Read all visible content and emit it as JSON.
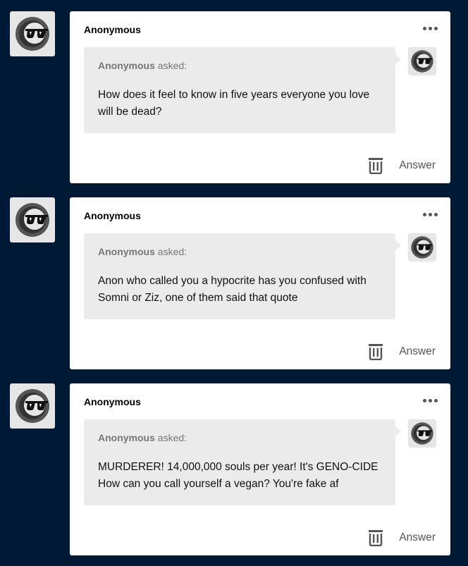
{
  "posts": [
    {
      "author": "Anonymous",
      "asker": "Anonymous",
      "asked_suffix": " asked:",
      "question": "How does it feel to know in five years everyone you love will be dead?",
      "answer_label": "Answer"
    },
    {
      "author": "Anonymous",
      "asker": "Anonymous",
      "asked_suffix": " asked:",
      "question": "Anon who called you a hypocrite has you confused with Somni or Ziz, one of them said that quote",
      "answer_label": "Answer"
    },
    {
      "author": "Anonymous",
      "asker": "Anonymous",
      "asked_suffix": " asked:",
      "question": "MURDERER! 14,000,000 souls per year! It's GENO-CIDE How can you call yourself a vegan? You're fake af",
      "answer_label": "Answer"
    }
  ],
  "icons": {
    "avatar": "anonymous-sunglasses-icon",
    "more": "more-options-icon",
    "delete": "trash-icon"
  },
  "colors": {
    "background": "#001935",
    "card": "#ffffff",
    "bubble": "#ebebeb",
    "avatar_bg": "#e6e6e6"
  }
}
